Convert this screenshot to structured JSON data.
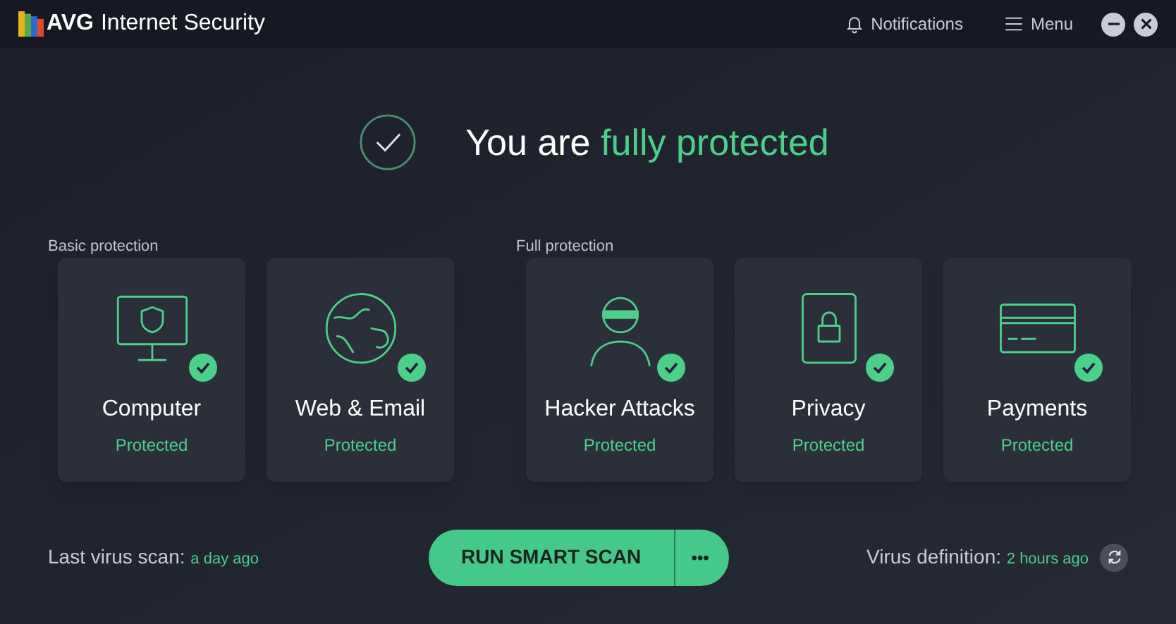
{
  "app": {
    "logo": "AVG",
    "title": "Internet Security"
  },
  "header": {
    "notifications": "Notifications",
    "menu": "Menu"
  },
  "hero": {
    "text": "You are",
    "highlight": "fully protected",
    "protected": true
  },
  "groups": [
    {
      "label": "Basic protection",
      "cards": [
        {
          "kind": "computer",
          "title": "Computer",
          "status": "Protected",
          "protected": true
        },
        {
          "kind": "globe",
          "title": "Web & Email",
          "status": "Protected",
          "protected": true
        }
      ]
    },
    {
      "label": "Full protection",
      "cards": [
        {
          "kind": "hacker",
          "title": "Hacker Attacks",
          "status": "Protected",
          "protected": true
        },
        {
          "kind": "lock",
          "title": "Privacy",
          "status": "Protected",
          "protected": true
        },
        {
          "kind": "card",
          "title": "Payments",
          "status": "Protected",
          "protected": true
        }
      ]
    }
  ],
  "footer": {
    "last_scan_label": "Last virus scan:",
    "last_scan_value": "a day ago",
    "scan_button": "RUN SMART SCAN",
    "more_button": "•••",
    "definition_label": "Virus definition:",
    "definition_value": "2 hours ago"
  }
}
